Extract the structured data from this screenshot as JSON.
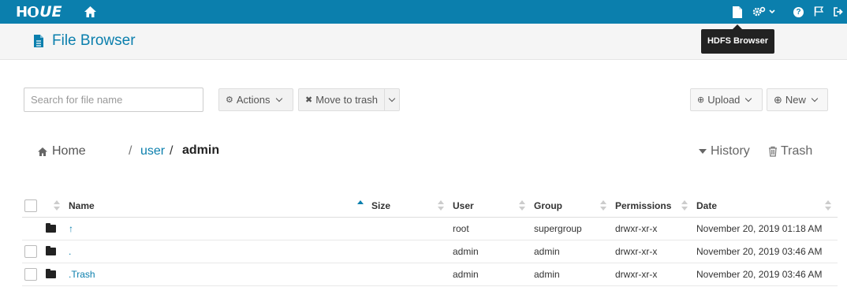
{
  "app": {
    "logo_alt": "HUE",
    "logo_h": "H",
    "logo_ue": "UE",
    "accent": "#0b7fad"
  },
  "topnav": {
    "help_glyph": "?",
    "tooltip": "HDFS Browser"
  },
  "header": {
    "title": "File Browser"
  },
  "toolbar": {
    "search_placeholder": "Search for file name",
    "actions_label": "Actions",
    "move_to_trash_label": "Move to trash",
    "upload_label": "Upload",
    "new_label": "New"
  },
  "breadcrumb": {
    "home": "Home",
    "sep": "/",
    "segments": [
      "user",
      "admin"
    ]
  },
  "links": {
    "history": "History",
    "trash": "Trash"
  },
  "table": {
    "columns": [
      "Name",
      "Size",
      "User",
      "Group",
      "Permissions",
      "Date"
    ],
    "rows": [
      {
        "name": "↑",
        "size": "",
        "user": "root",
        "group": "supergroup",
        "permissions": "drwxr-xr-x",
        "date": "November 20, 2019 01:18 AM",
        "has_checkbox": false
      },
      {
        "name": ".",
        "size": "",
        "user": "admin",
        "group": "admin",
        "permissions": "drwxr-xr-x",
        "date": "November 20, 2019 03:46 AM",
        "has_checkbox": true
      },
      {
        "name": ".Trash",
        "size": "",
        "user": "admin",
        "group": "admin",
        "permissions": "drwxr-xr-x",
        "date": "November 20, 2019 03:46 AM",
        "has_checkbox": true
      }
    ]
  }
}
